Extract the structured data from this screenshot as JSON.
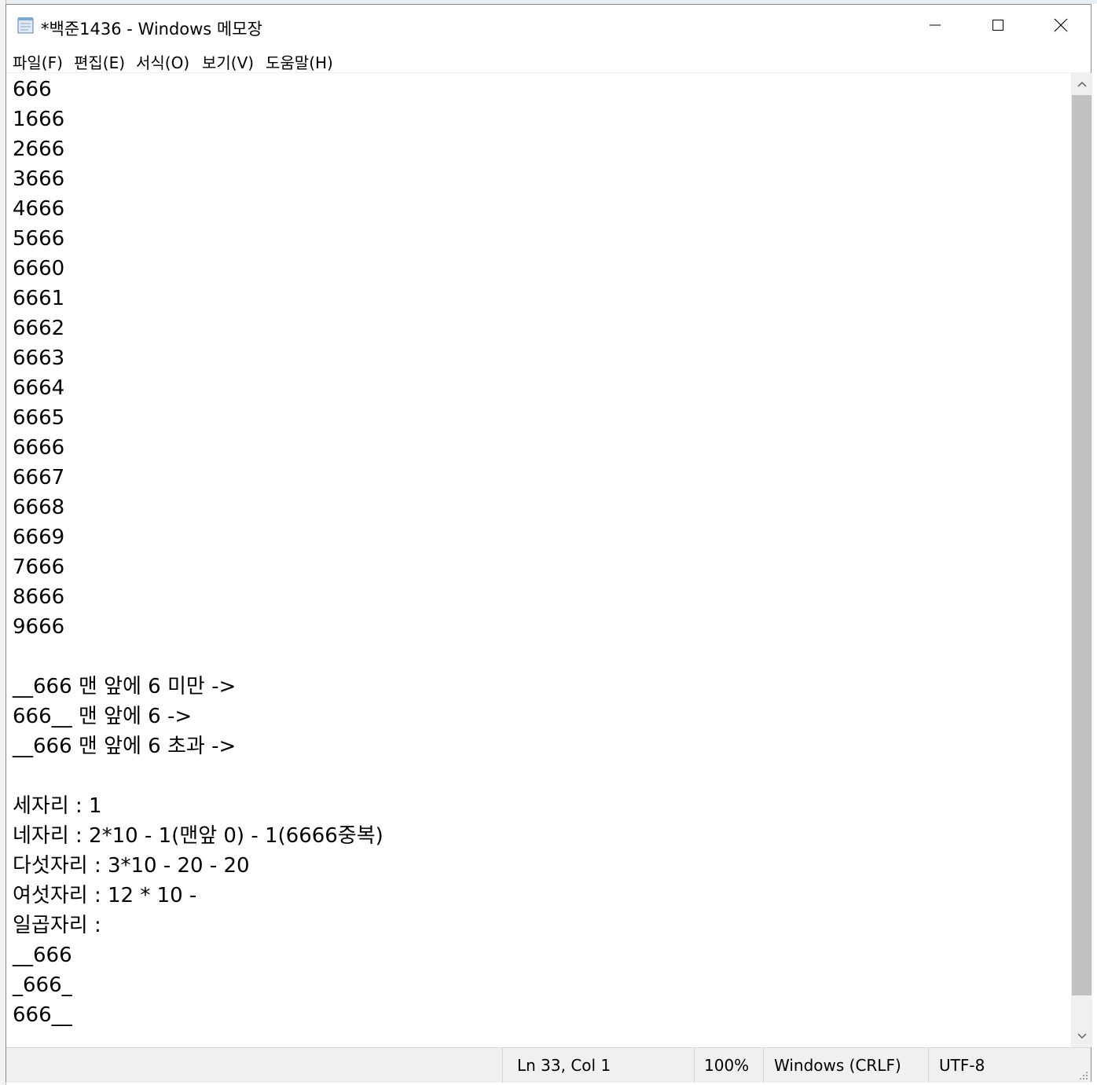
{
  "window": {
    "title": "*백준1436 - Windows 메모장",
    "controls": {
      "minimize": "minimize-icon",
      "maximize": "maximize-icon",
      "close": "close-icon"
    }
  },
  "menubar": {
    "items": [
      {
        "label": "파일(F)"
      },
      {
        "label": "편집(E)"
      },
      {
        "label": "서식(O)"
      },
      {
        "label": "보기(V)"
      },
      {
        "label": "도움말(H)"
      }
    ]
  },
  "editor": {
    "lines": [
      "666",
      "1666",
      "2666",
      "3666",
      "4666",
      "5666",
      "6660",
      "6661",
      "6662",
      "6663",
      "6664",
      "6665",
      "6666",
      "6667",
      "6668",
      "6669",
      "7666",
      "8666",
      "9666",
      "",
      "__666 맨 앞에 6 미만 ->",
      "666__ 맨 앞에 6 ->",
      "__666 맨 앞에 6 초과 ->",
      "",
      "세자리 : 1",
      "네자리 : 2*10 - 1(맨앞 0) - 1(6666중복)",
      "다섯자리 : 3*10 - 20 - 20",
      "여섯자리 : 12 * 10 -",
      "일곱자리 :",
      "__666",
      "_666_",
      "666__"
    ]
  },
  "statusbar": {
    "position": "Ln 33, Col 1",
    "zoom": "100%",
    "line_ending": "Windows (CRLF)",
    "encoding": "UTF-8"
  },
  "colors": {
    "chrome": "#f0f0f0",
    "scroll_thumb": "#c1c1c1",
    "border": "#8a8a8a"
  }
}
